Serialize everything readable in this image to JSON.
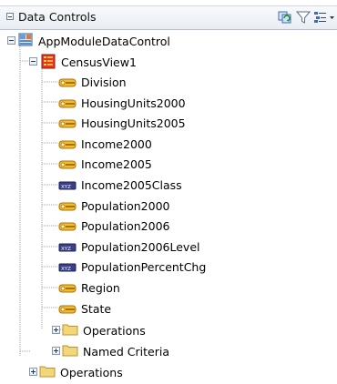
{
  "panel": {
    "title": "Data Controls",
    "toolbar": {
      "refresh_icon": "refresh-icon",
      "filter_icon": "filter-icon",
      "menu_icon": "list-options-icon"
    }
  },
  "tree": {
    "root": {
      "label": "AppModuleDataControl",
      "icon": "data-control-icon",
      "expanded": true,
      "view": {
        "label": "CensusView1",
        "icon": "view-object-icon",
        "expanded": true,
        "attributes": [
          {
            "label": "Division",
            "icon": "key-attribute-icon"
          },
          {
            "label": "HousingUnits2000",
            "icon": "key-attribute-icon"
          },
          {
            "label": "HousingUnits2005",
            "icon": "key-attribute-icon"
          },
          {
            "label": "Income2000",
            "icon": "key-attribute-icon"
          },
          {
            "label": "Income2005",
            "icon": "key-attribute-icon"
          },
          {
            "label": "Income2005Class",
            "icon": "xyz-attribute-icon"
          },
          {
            "label": "Population2000",
            "icon": "key-attribute-icon"
          },
          {
            "label": "Population2006",
            "icon": "key-attribute-icon"
          },
          {
            "label": "Population2006Level",
            "icon": "xyz-attribute-icon"
          },
          {
            "label": "PopulationPercentChg",
            "icon": "xyz-attribute-icon"
          },
          {
            "label": "Region",
            "icon": "key-attribute-icon"
          },
          {
            "label": "State",
            "icon": "key-attribute-icon"
          }
        ],
        "folders": [
          {
            "label": "Operations",
            "icon": "folder-icon",
            "expanded": false
          },
          {
            "label": "Named Criteria",
            "icon": "folder-icon",
            "expanded": false
          }
        ]
      },
      "folders": [
        {
          "label": "Operations",
          "icon": "folder-icon",
          "expanded": false
        }
      ]
    }
  },
  "colors": {
    "folder": "#f2d77a",
    "key_icon": "#e3a51a",
    "view_icon": "#e8351f",
    "header_bg": "#eef1f5"
  }
}
